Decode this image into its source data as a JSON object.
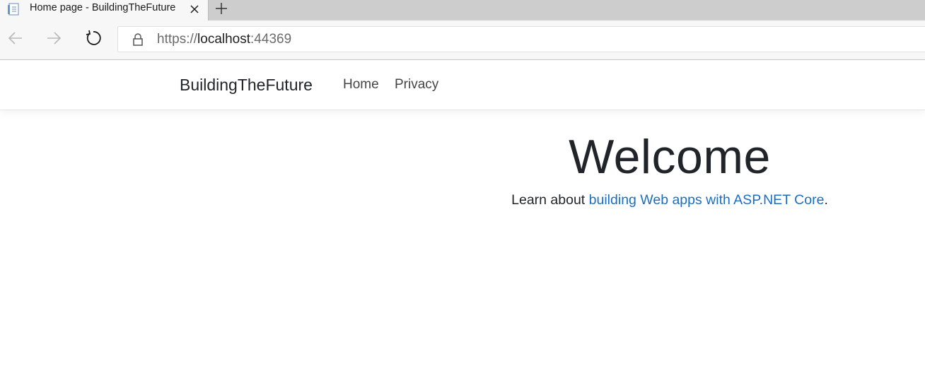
{
  "browser": {
    "tab": {
      "title": "Home page - BuildingTheFuture",
      "favicon": "page-icon",
      "close_icon": "close-icon"
    },
    "new_tab_icon": "plus-icon",
    "nav": {
      "back_icon": "arrow-left-icon",
      "forward_icon": "arrow-right-icon",
      "refresh_icon": "refresh-icon"
    },
    "address": {
      "lock_icon": "lock-icon",
      "scheme": "https://",
      "host": "localhost",
      "port": ":44369"
    }
  },
  "site": {
    "brand": "BuildingTheFuture",
    "nav_items": [
      {
        "label": "Home"
      },
      {
        "label": "Privacy"
      }
    ]
  },
  "main": {
    "heading": "Welcome",
    "lead_prefix": "Learn about ",
    "lead_link": "building Web apps with ASP.NET Core",
    "lead_suffix": "."
  },
  "colors": {
    "link": "#1b6ec2",
    "text": "#212529",
    "chrome_bg": "#f7f7f7",
    "tabstrip_bg": "#cdcdcd"
  }
}
